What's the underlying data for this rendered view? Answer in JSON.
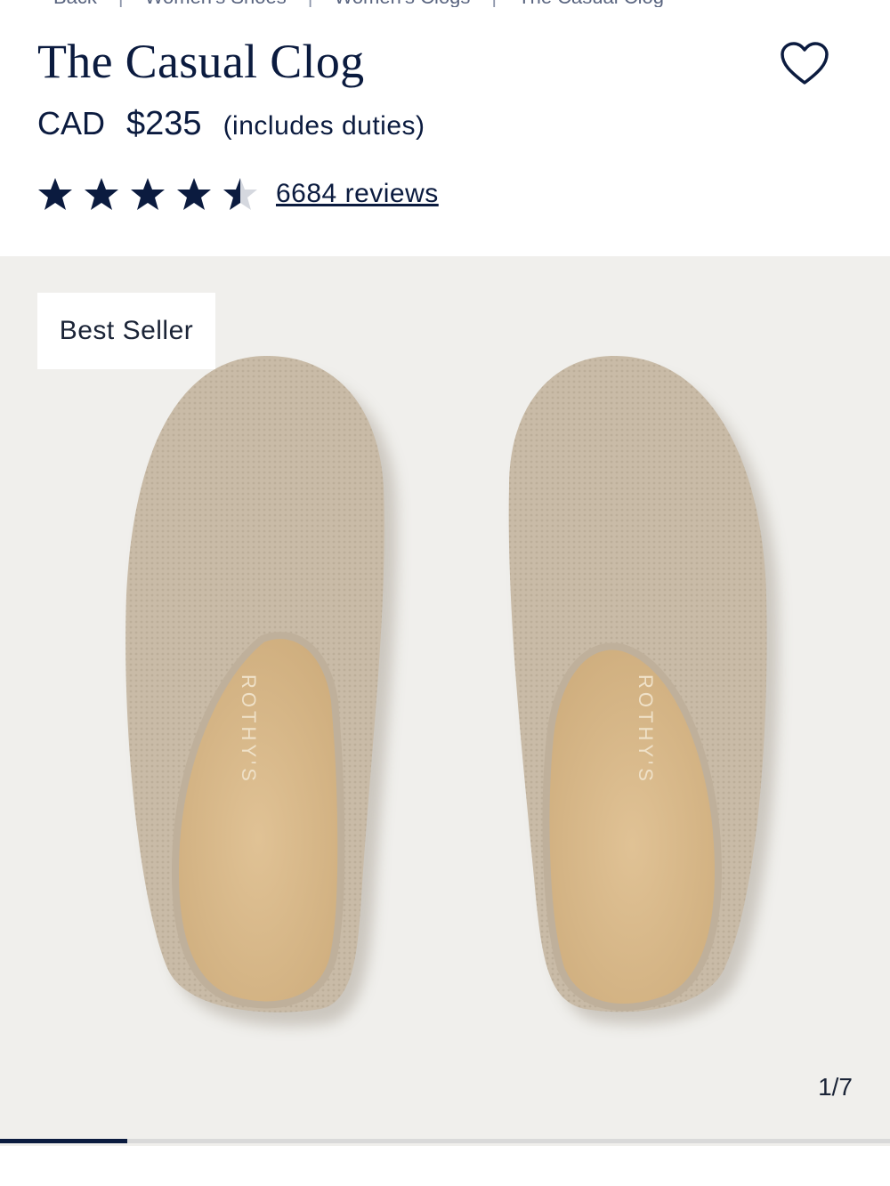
{
  "breadcrumb": {
    "items": [
      "Back",
      "Women's Shoes",
      "Women's Clogs",
      "The Casual Clog"
    ]
  },
  "product": {
    "title": "The Casual Clog",
    "currency": "CAD",
    "price": "$235",
    "price_note": "(includes duties)",
    "rating": 4.5,
    "rating_max": 5,
    "reviews_label": "6684 reviews",
    "badge": "Best Seller",
    "insole_brand": "ROTHY'S"
  },
  "gallery": {
    "counter": "1/7",
    "current": 1,
    "total": 7
  },
  "colors": {
    "navy": "#0b1b3f",
    "gallery_bg": "#f0efec",
    "knit": "#c9bba7",
    "insole": "#d9b98a"
  },
  "icons": {
    "wishlist": "heart-outline-icon",
    "star": "star-icon"
  }
}
